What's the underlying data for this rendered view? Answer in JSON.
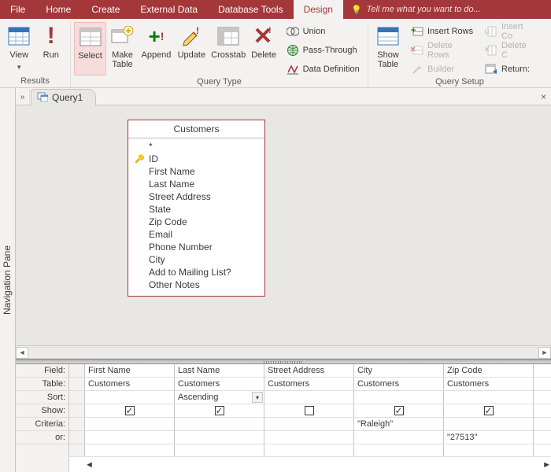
{
  "tabs": {
    "file": "File",
    "home": "Home",
    "create": "Create",
    "external": "External Data",
    "dbtools": "Database Tools",
    "design": "Design",
    "tellme": "Tell me what you want to do..."
  },
  "ribbon": {
    "view": "View",
    "run": "Run",
    "select": "Select",
    "make_table": "Make\nTable",
    "append": "Append",
    "update": "Update",
    "crosstab": "Crosstab",
    "delete": "Delete",
    "union": "Union",
    "passthrough": "Pass-Through",
    "datadef": "Data Definition",
    "showtable": "Show\nTable",
    "insertrows": "Insert Rows",
    "deleterows": "Delete Rows",
    "builder": "Builder",
    "insertcols": "Insert Co",
    "deletecols": "Delete C",
    "return": "Return:",
    "group_results": "Results",
    "group_qtype": "Query Type",
    "group_qsetup": "Query Setup"
  },
  "nav": {
    "pane_label": "Navigation Pane",
    "toggle": "»"
  },
  "query": {
    "tab_name": "Query1",
    "table_name": "Customers",
    "fields_star": "*",
    "fields": [
      "ID",
      "First Name",
      "Last Name",
      "Street Address",
      "State",
      "Zip Code",
      "Email",
      "Phone Number",
      "City",
      "Add to Mailing List?",
      "Other Notes"
    ],
    "key_field_index": 0
  },
  "grid": {
    "labels": {
      "field": "Field:",
      "table": "Table:",
      "sort": "Sort:",
      "show": "Show:",
      "criteria": "Criteria:",
      "or": "or:"
    },
    "columns": [
      {
        "field": "First Name",
        "table": "Customers",
        "sort": "",
        "show": true,
        "criteria": "",
        "or": ""
      },
      {
        "field": "Last Name",
        "table": "Customers",
        "sort": "Ascending",
        "show": true,
        "criteria": "",
        "or": ""
      },
      {
        "field": "Street Address",
        "table": "Customers",
        "sort": "",
        "show": false,
        "criteria": "",
        "or": ""
      },
      {
        "field": "City",
        "table": "Customers",
        "sort": "",
        "show": true,
        "criteria": "\"Raleigh\"",
        "or": ""
      },
      {
        "field": "Zip Code",
        "table": "Customers",
        "sort": "",
        "show": true,
        "criteria": "",
        "or": "\"27513\""
      }
    ],
    "sort_dropdown_col": 1
  }
}
